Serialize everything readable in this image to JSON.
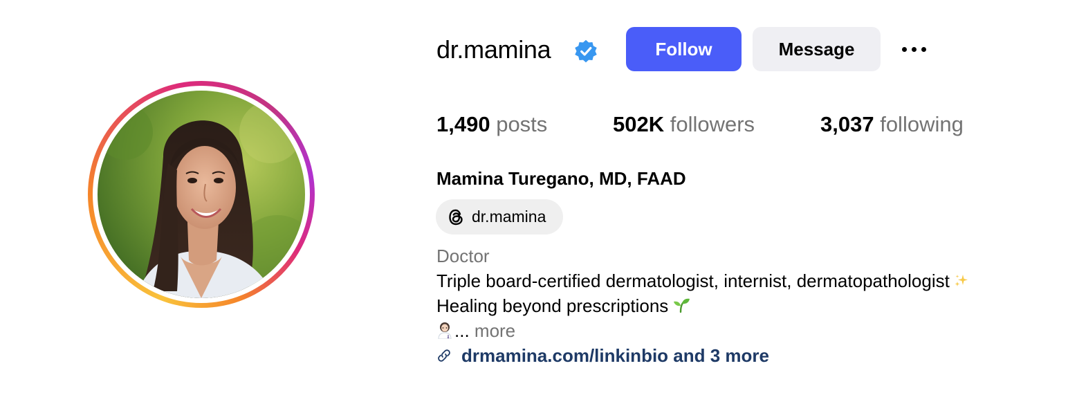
{
  "profile": {
    "username": "dr.mamina",
    "verified": true,
    "full_name": "Mamina Turegano, MD, FAAD",
    "threads_handle": "dr.mamina",
    "category": "Doctor",
    "bio_lines": [
      "Triple board-certified dermatologist, internist, dermatopathologist",
      "Healing beyond prescriptions"
    ],
    "bio_truncated": "...",
    "more_label": "more",
    "link_text": "drmamina.com/linkinbio and 3 more"
  },
  "actions": {
    "follow_label": "Follow",
    "message_label": "Message"
  },
  "stats": {
    "posts_count": "1,490",
    "posts_label": "posts",
    "followers_count": "502K",
    "followers_label": "followers",
    "following_count": "3,037",
    "following_label": "following"
  },
  "icons": {
    "verified": "verified-badge-icon",
    "more": "more-options-icon",
    "threads": "threads-icon",
    "link": "link-icon",
    "sparkles": "sparkles-emoji",
    "seedling": "seedling-emoji",
    "doctor": "woman-health-worker-emoji"
  },
  "colors": {
    "follow_button": "#4a5df9",
    "message_button": "#efeff3",
    "verified_badge": "#3897f0",
    "secondary_text": "#737373",
    "link_text": "#1e3a66"
  }
}
